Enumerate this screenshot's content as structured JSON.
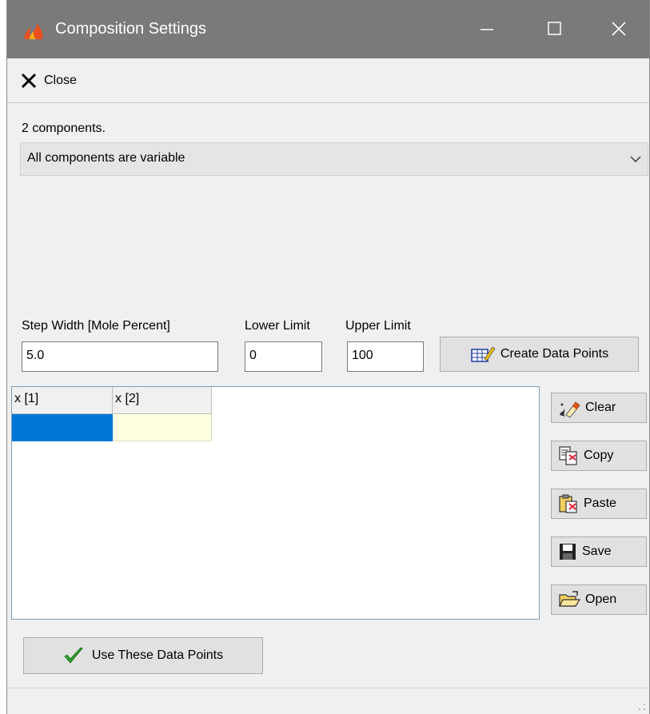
{
  "window": {
    "title": "Composition Settings",
    "icon": "flame-icon"
  },
  "toolbar": {
    "close_label": "Close",
    "close_icon": "close-x-icon"
  },
  "components": {
    "count_text": "2 components.",
    "mode_selected": "All components are variable"
  },
  "parameters": {
    "step_width_label": "Step Width [Mole Percent]",
    "step_width_value": "5.0",
    "lower_limit_label": "Lower Limit",
    "lower_limit_value": "0",
    "upper_limit_label": "Upper Limit",
    "upper_limit_value": "100",
    "create_button_label": "Create Data Points"
  },
  "grid": {
    "columns": [
      "x [1]",
      "x [2]"
    ],
    "rows": [
      [
        "",
        ""
      ]
    ]
  },
  "side_buttons": {
    "clear": "Clear",
    "copy": "Copy",
    "paste": "Paste",
    "save": "Save",
    "open": "Open"
  },
  "use_button_label": "Use These Data Points",
  "colors": {
    "titlebar": "#7a7a7a",
    "selection": "#0078d7",
    "cell_highlight": "#ffffe1",
    "check": "#2ea02e"
  }
}
